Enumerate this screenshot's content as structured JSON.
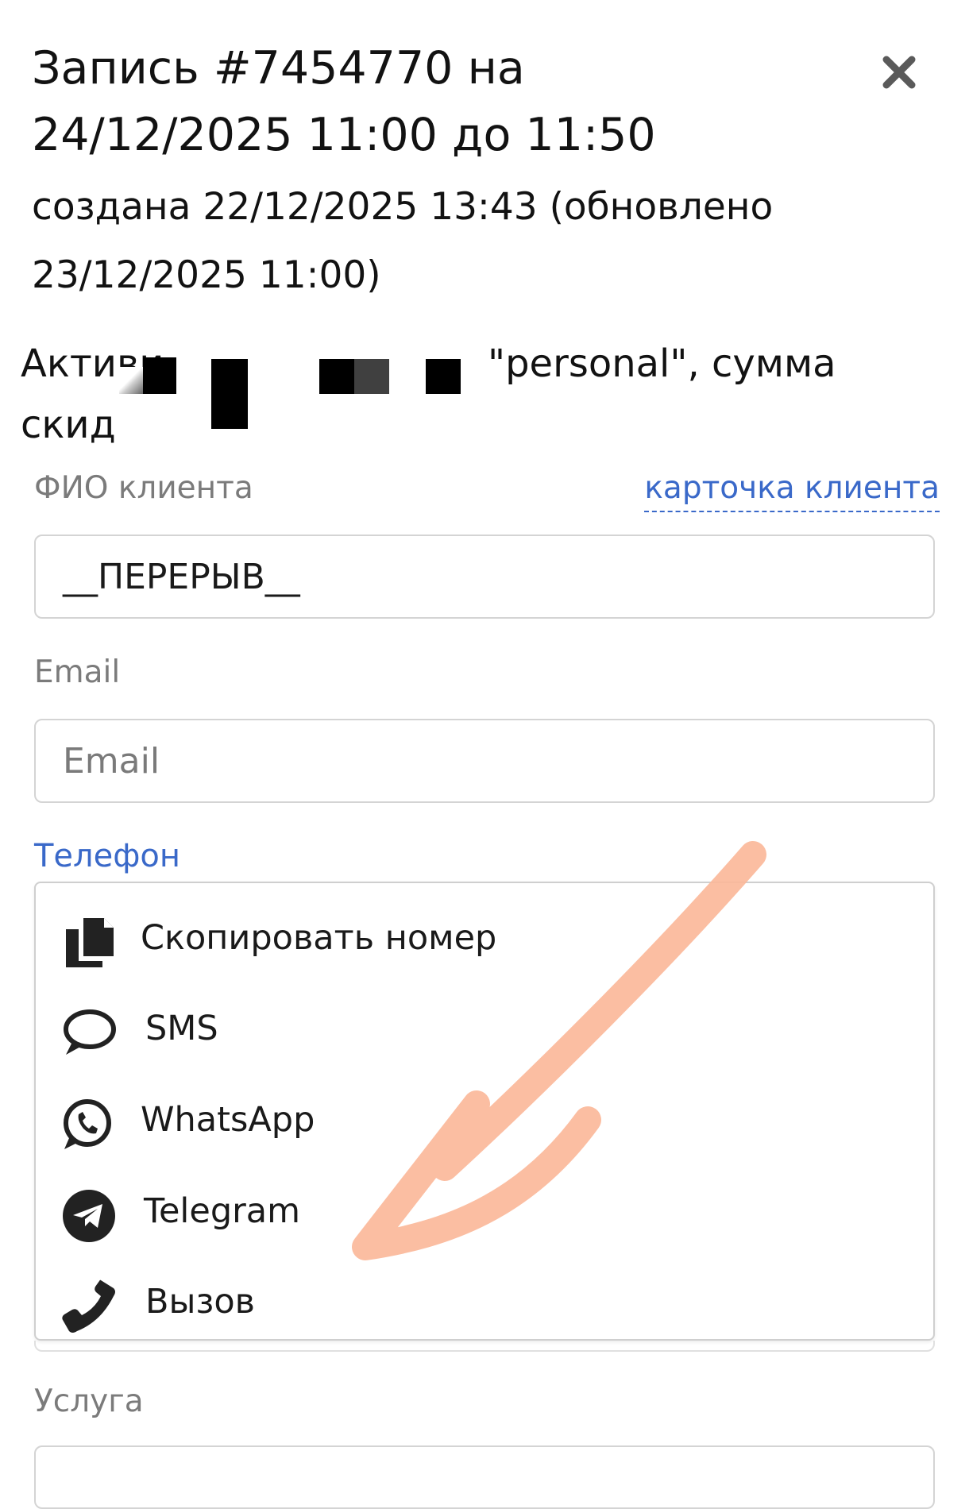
{
  "header": {
    "title": "Запись #7454770 на 24/12/2025 11:00 до 11:50",
    "created": "создана 22/12/2025 13:43 (обновлено 23/12/2025 11:00)"
  },
  "notice": {
    "left_text": "Активи скид",
    "right_text": "\"personal\", сумма"
  },
  "client": {
    "name_label": "ФИО клиента",
    "card_link": "карточка клиента",
    "name_value": "__ПЕРЕРЫВ__"
  },
  "email": {
    "label": "Email",
    "placeholder": "Email"
  },
  "phone": {
    "label": "Телефон",
    "menu": [
      {
        "icon": "copy-icon",
        "label": "Скопировать номер"
      },
      {
        "icon": "sms-bubble-icon",
        "label": "SMS"
      },
      {
        "icon": "whatsapp-icon",
        "label": "WhatsApp"
      },
      {
        "icon": "telegram-icon",
        "label": "Telegram"
      },
      {
        "icon": "phone-call-icon",
        "label": "Вызов"
      }
    ]
  },
  "service": {
    "label": "Услуга"
  },
  "colors": {
    "link": "#3a69c9",
    "arrow": "#fbb89a",
    "border": "#d4d4d4"
  }
}
